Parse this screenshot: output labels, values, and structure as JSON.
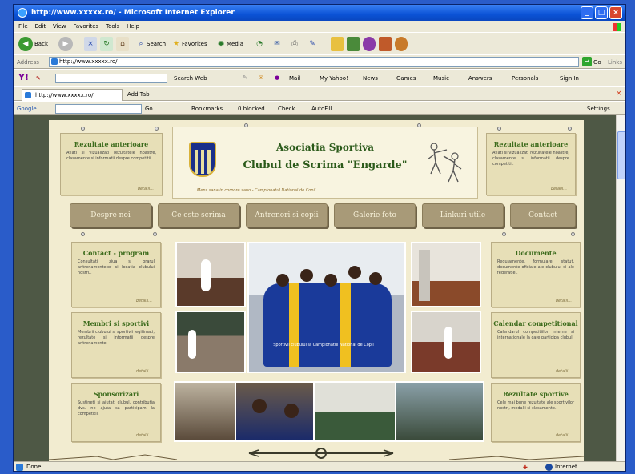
{
  "window": {
    "title": "http://www.xxxxx.ro/ - Microsoft Internet Explorer"
  },
  "menu": [
    "File",
    "Edit",
    "View",
    "Favorites",
    "Tools",
    "Help"
  ],
  "toolbar": {
    "back_label": "Back",
    "search_label": "Search",
    "favorites_label": "Favorites",
    "media_label": "Media"
  },
  "address": {
    "label": "Address",
    "value": "http://www.xxxxx.ro/",
    "go_label": "Go",
    "links_label": "Links"
  },
  "yahoo_bar": {
    "search_web_label": "Search Web",
    "mail_label": "Mail",
    "my_yahoo_label": "My Yahoo!",
    "news_label": "News",
    "games_label": "Games",
    "music_label": "Music",
    "answers_label": "Answers",
    "personals_label": "Personals",
    "sign_in_label": "Sign In"
  },
  "tab": {
    "label": "http://www.xxxxx.ro/",
    "add_tab_label": "Add Tab"
  },
  "google_bar": {
    "label": "Google",
    "go_label": "Go",
    "bookmarks_label": "Bookmarks",
    "popups_label": "0 blocked",
    "check_label": "Check",
    "autofill_label": "AutoFill",
    "settings_label": "Settings"
  },
  "status": {
    "left": "Done",
    "zone": "Internet"
  },
  "site": {
    "club_name_1": "Asociatia Sportiva",
    "club_name_2": "Clubul de Scrima \"Engarde\"",
    "tagline": "Mens sana in corpore sano - Campionatul National de Copii...",
    "nav": [
      "Despre noi",
      "Ce este scrima",
      "Antrenori si copii",
      "Galerie foto",
      "Linkuri utile",
      "Contact"
    ],
    "left_boxes": [
      {
        "title": "Rezultate anterioare",
        "text": "Aflati si vizualizati rezultatele noastre, clasamente si informatii despre competitii.",
        "more": "detalii..."
      },
      {
        "title": "Contact - program",
        "text": "Consultati ziua si orarul antrenamentelor si locatia clubului nostru.",
        "more": "detalii..."
      },
      {
        "title": "Membri si sportivi",
        "text": "Membrii clubului si sportivii legitimati, rezultate si informatii despre antrenamente.",
        "more": "detalii..."
      },
      {
        "title": "Sponsorizari",
        "text": "Sustineti si ajutati clubul, contributia dvs. ne ajuta sa participam la competitii.",
        "more": "detalii..."
      }
    ],
    "right_boxes": [
      {
        "title": "Rezultate anterioare",
        "text": "Aflati si vizualizati rezultatele noastre, clasamente si informatii despre competitii.",
        "more": "detalii..."
      },
      {
        "title": "Documente",
        "text": "Regulamente, formulare, statut, documente oficiale ale clubului si ale federatiei.",
        "more": "detalii..."
      },
      {
        "title": "Calendar competitional",
        "text": "Calendarul competitiilor interne si internationale la care participa clubul.",
        "more": "detalii..."
      },
      {
        "title": "Rezultate sportive",
        "text": "Cele mai bune rezultate ale sportivilor nostri, medalii si clasamente.",
        "more": "detalii..."
      }
    ],
    "photo_caption": "Sportivii clubului la Campionatul National de Copii"
  },
  "colors": {
    "page_bg": "#f2ecd0",
    "parchment": "#e7dfb7",
    "nav_button": "#a89a78",
    "title_green": "#3c6b1c",
    "surround": "#4e5845"
  }
}
